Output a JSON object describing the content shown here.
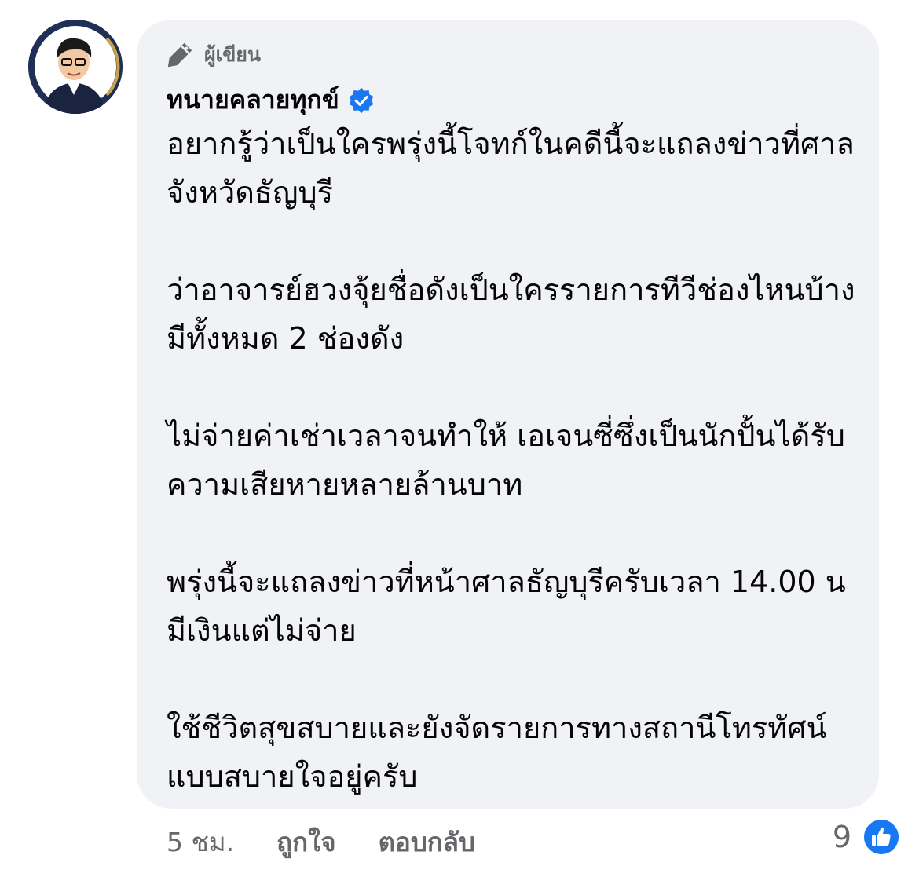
{
  "avatar": {
    "caption": "ทนายคลายทุกข์"
  },
  "badge": {
    "label": "ผู้เขียน",
    "icon": "pen-icon"
  },
  "author": {
    "name": "ทนายคลายทุกข์",
    "verified_icon": "verified-badge-icon"
  },
  "comment": {
    "paragraphs": [
      "อยากรู้ว่าเป็นใครพรุ่งนี้โจทก์ในคดีนี้จะแถลงข่าวที่ศาลจังหวัดธัญบุรี",
      "ว่าอาจารย์ฮวงจุ้ยชื่อดังเป็นใครรายการทีวีช่องไหนบ้างมีทั้งหมด 2 ช่องดัง",
      "ไม่จ่ายค่าเช่าเวลาจนทำให้ เอเจนซี่ซึ่งเป็นนักปั้นได้รับความเสียหายหลายล้านบาท",
      "พรุ่งนี้จะแถลงข่าวที่หน้าศาลธัญบุรีครับเวลา 14.00 น มีเงินแต่ไม่จ่าย",
      "ใช้ชีวิตสุขสบายและยังจัดรายการทางสถานีโทรทัศน์แบบสบายใจอยู่ครับ"
    ]
  },
  "actions": {
    "time": "5 ชม.",
    "like": "ถูกใจ",
    "reply": "ตอบกลับ"
  },
  "reactions": {
    "count": "9",
    "icon": "like-reaction-icon"
  },
  "colors": {
    "bubble": "#f0f2f5",
    "secondary_text": "#65676b",
    "accent": "#1877f2"
  }
}
